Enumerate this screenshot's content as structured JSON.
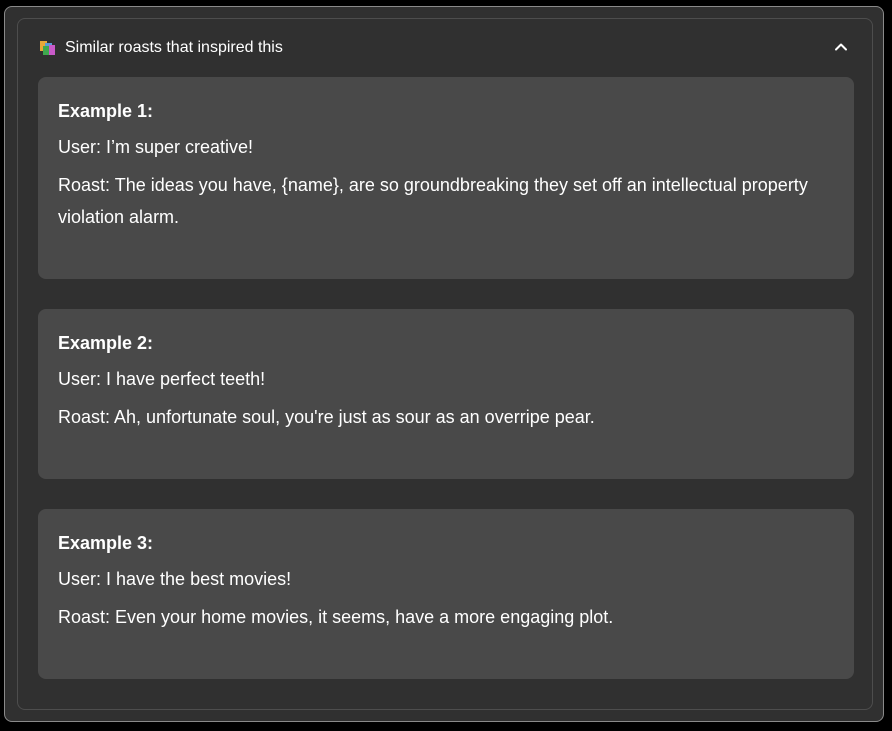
{
  "expander": {
    "title": "Similar roasts that inspired this",
    "icon": "books-icon",
    "expanded": true
  },
  "examples": [
    {
      "title": "Example 1:",
      "user": "User: I’m super creative!",
      "roast": "Roast: The ideas you have, {name}, are so groundbreaking they set off an intellectual property violation alarm."
    },
    {
      "title": "Example 2:",
      "user": "User: I have perfect teeth!",
      "roast": "Roast: Ah, unfortunate soul, you're just as sour as an overripe pear."
    },
    {
      "title": "Example 3:",
      "user": "User: I have the best movies!",
      "roast": "Roast: Even your home movies, it seems, have a more engaging plot."
    }
  ],
  "colors": {
    "background": "#303030",
    "card": "#494949",
    "text": "#ffffff"
  }
}
